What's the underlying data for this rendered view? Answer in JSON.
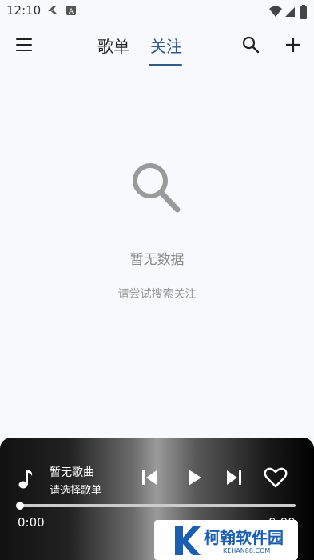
{
  "status": {
    "time": "12:10"
  },
  "tabs": [
    {
      "label": "歌单",
      "active": false
    },
    {
      "label": "关注",
      "active": true
    }
  ],
  "empty_state": {
    "title": "暂无数据",
    "subtitle": "请尝试搜索关注"
  },
  "player": {
    "song_title": "暂无歌曲",
    "song_subtitle": "请选择歌单",
    "time_current": "0:00",
    "time_total": "0:00",
    "progress": 0
  },
  "watermark": {
    "name": "柯翰软件园",
    "url": "KEHAN88.COM"
  },
  "colors": {
    "accent": "#2f5c8a",
    "background": "#f8f9fd"
  },
  "icons": [
    "menu-icon",
    "search-icon",
    "add-icon",
    "music-note-icon",
    "skip-previous-icon",
    "play-icon",
    "skip-next-icon",
    "heart-icon"
  ]
}
